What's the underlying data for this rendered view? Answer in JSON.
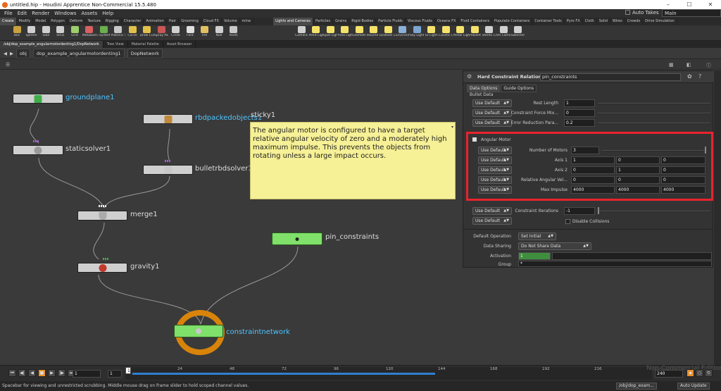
{
  "window": {
    "title": "untitled.hip - Houdini Apprentice Non-Commercial 15.5.480",
    "controls": [
      "–",
      "☐",
      "✕"
    ]
  },
  "menu": [
    "File",
    "Edit",
    "Render",
    "Windows",
    "Assets",
    "Help"
  ],
  "takes": {
    "auto_label": "Auto Takes",
    "selected": "Main"
  },
  "shelf_tabs_left": [
    "Create",
    "Modify",
    "Model",
    "Polygon",
    "Deform",
    "Texture",
    "Rigging",
    "Character",
    "Animation",
    "Hair",
    "Grooming",
    "Cloud FX",
    "Volume",
    "mine"
  ],
  "shelf_tabs_right": [
    "Lights and Cameras",
    "Particles",
    "Grains",
    "Rigid Bodies",
    "Particle Fluids",
    "Viscous Fluids",
    "Oceans FX",
    "Fluid Containers",
    "Populate Containers",
    "Container Tools",
    "Pyro FX",
    "Cloth",
    "Solid",
    "Wires",
    "Crowds",
    "Drive Simulation"
  ],
  "tools_left": [
    {
      "label": "Box",
      "color": "#c9a23c"
    },
    {
      "label": "Sphere",
      "color": "#cfcfcf"
    },
    {
      "label": "Tube",
      "color": "#cfcfcf"
    },
    {
      "label": "Torus",
      "color": "#cfcfcf"
    },
    {
      "label": "Grid",
      "color": "#9ccf6a"
    },
    {
      "label": "Metaball",
      "color": "#d76060"
    },
    {
      "label": "L-System",
      "color": "#6ab04c"
    },
    {
      "label": "Platonic Sol...",
      "color": "#c8c8c8"
    },
    {
      "label": "Curve",
      "color": "#e2c14a"
    },
    {
      "label": "Draw Curve",
      "color": "#e2c14a"
    },
    {
      "label": "Spray Paint",
      "color": "#cc5555"
    },
    {
      "label": "Circle",
      "color": "#d0d0d0"
    },
    {
      "label": "Font",
      "color": "#e0e0e0"
    },
    {
      "label": "File",
      "color": "#e0c060"
    },
    {
      "label": "Null",
      "color": "#d0d0d0"
    },
    {
      "label": "Rivet",
      "color": "#c8c8c8"
    }
  ],
  "tools_right": [
    {
      "label": "Camera",
      "color": "#d0d0d0"
    },
    {
      "label": "Point Light",
      "color": "#f5e26a"
    },
    {
      "label": "Spot Light",
      "color": "#f5e26a"
    },
    {
      "label": "Area Light",
      "color": "#f5e26a"
    },
    {
      "label": "Geometry L...",
      "color": "#f5e26a"
    },
    {
      "label": "Volume Light",
      "color": "#f5e26a"
    },
    {
      "label": "Distant Light",
      "color": "#f5e26a"
    },
    {
      "label": "Environmen...",
      "color": "#8ab0d8"
    },
    {
      "label": "Sky Light",
      "color": "#7aa6d0"
    },
    {
      "label": "GI Light",
      "color": "#f5e26a"
    },
    {
      "label": "Caustic Light",
      "color": "#f5e26a"
    },
    {
      "label": "Portal Light",
      "color": "#f5e26a"
    },
    {
      "label": "Ambient Lig...",
      "color": "#f5e26a"
    },
    {
      "label": "Stereo Cam...",
      "color": "#d0d0d0"
    },
    {
      "label": "VR Camera",
      "color": "#d0d0d0"
    },
    {
      "label": "Switcher",
      "color": "#d0d0d0"
    }
  ],
  "pane_tabs": [
    "/obj/dop_example_angularmotordenting1/DopNetwork",
    "Tree View",
    "Material Palette",
    "Asset Browser"
  ],
  "path": {
    "root": "obj",
    "network": "dop_example_angularmotordenting1",
    "dop": "DopNetwork"
  },
  "nodes": [
    {
      "id": "groundplane",
      "label": "groundplane1",
      "icon_color": "#3fae49"
    },
    {
      "id": "staticsolver",
      "label": "staticsolver1",
      "icon_color": "#9a9a9a"
    },
    {
      "id": "rbdpacked",
      "label": "rbdpackedobjects1",
      "icon_color": "#c08a3a"
    },
    {
      "id": "bulletsolver",
      "label": "bulletrbdsolver1",
      "icon_color": "#c8c8c8"
    },
    {
      "id": "merge",
      "label": "merge1",
      "icon_color": "#aaaaaa"
    },
    {
      "id": "gravity",
      "label": "gravity1",
      "icon_color": "#c0392b"
    },
    {
      "id": "pinconstraints",
      "label": "pin_constraints",
      "icon_color": "#222222"
    },
    {
      "id": "constraintnetwork",
      "label": "constraintnetwork",
      "icon_color": "#c8c8c8"
    }
  ],
  "sticky": {
    "title": "sticky1",
    "text": "The angular motor is configured to have a target relative angular velocity of zero and a moderately high maximum impulse. This prevents the objects from rotating unless a large impact occurs."
  },
  "params": {
    "node_type": "Hard Constraint Relationship",
    "node_name": "pin_constraints",
    "tabs": [
      "Data Options",
      "Guide Options"
    ],
    "section": "Bullet Data",
    "use_default": "Use Default",
    "rows": [
      {
        "label": "Rest Length",
        "value": "1"
      },
      {
        "label": "Constraint Force Mix...",
        "value": "0"
      },
      {
        "label": "Error Reduction Para...",
        "value": "0.2"
      }
    ],
    "angular": {
      "title": "Angular Motor",
      "num_motors_label": "Number of Motors",
      "num_motors": "3",
      "axis1_label": "Axis 1",
      "axis1": [
        "1",
        "0",
        "0"
      ],
      "axis2_label": "Axis 2",
      "axis2": [
        "0",
        "1",
        "0"
      ],
      "rel_label": "Relative Angular Vel...",
      "rel": [
        "0",
        "0",
        "0"
      ],
      "impulse_label": "Max Impulse",
      "impulse": [
        "4000",
        "4000",
        "4000"
      ]
    },
    "iterations_label": "Constraint Iterations",
    "iterations": "-1",
    "disable_collisions": "Disable Collisions",
    "default_op_label": "Default Operation",
    "default_op": "Set Initial",
    "data_sharing_label": "Data Sharing",
    "data_sharing": "Do Not Share Data",
    "activation_label": "Activation",
    "activation": "1",
    "group_label": "Group",
    "group": "*"
  },
  "timeline": {
    "start": "1",
    "current": "1",
    "step": "1",
    "end": "240",
    "ticks": [
      "24",
      "48",
      "72",
      "96",
      "120",
      "144",
      "168",
      "192",
      "216"
    ],
    "watermark": "Non-Commercial Edition"
  },
  "status": {
    "text": "Spacebar for viewing and unrestricted scrubbing. Middle mouse drag on frame slider to hold scoped channel values.",
    "path": "/obj/dop_exam...",
    "update": "Auto Update"
  }
}
